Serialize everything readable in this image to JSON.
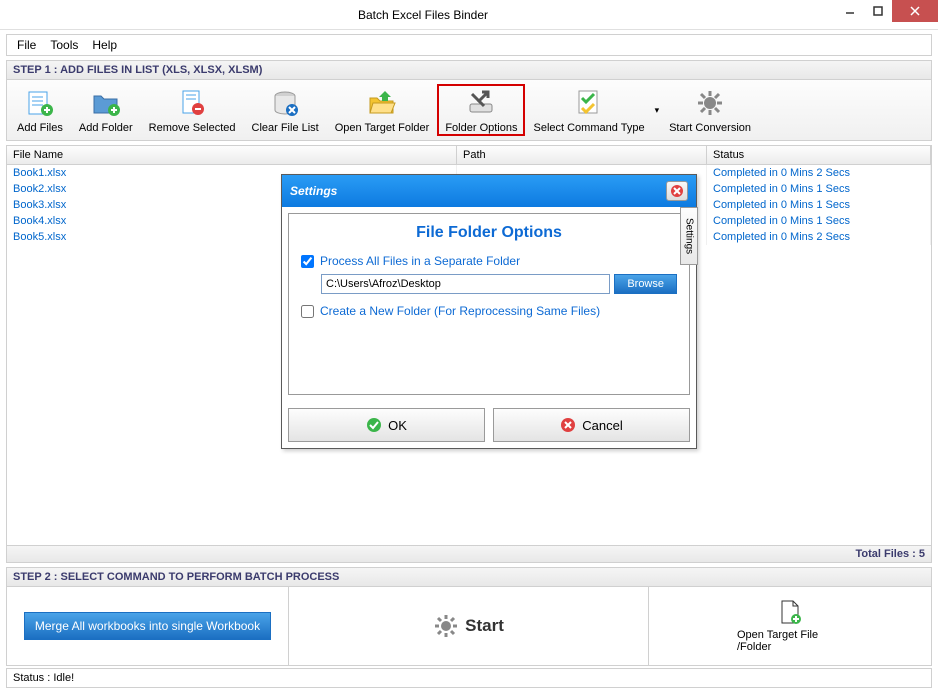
{
  "window": {
    "title": "Batch Excel Files Binder"
  },
  "menu": {
    "file": "File",
    "tools": "Tools",
    "help": "Help"
  },
  "step1": {
    "label": "STEP 1 : ADD FILES IN LIST (XLS, XLSX, XLSM)"
  },
  "toolbar": {
    "add_files": "Add Files",
    "add_folder": "Add Folder",
    "remove_selected": "Remove Selected",
    "clear_list": "Clear File List",
    "open_target": "Open Target Folder",
    "folder_options": "Folder Options",
    "select_command": "Select Command Type",
    "start_conversion": "Start Conversion"
  },
  "grid": {
    "col_filename": "File Name",
    "col_path": "Path",
    "col_status": "Status",
    "rows": [
      {
        "file": "Book1.xlsx",
        "status": "Completed in 0 Mins 2 Secs"
      },
      {
        "file": "Book2.xlsx",
        "status": "Completed in 0 Mins 1 Secs"
      },
      {
        "file": "Book3.xlsx",
        "status": "Completed in 0 Mins 1 Secs"
      },
      {
        "file": "Book4.xlsx",
        "status": "Completed in 0 Mins 1 Secs"
      },
      {
        "file": "Book5.xlsx",
        "status": "Completed in 0 Mins 2 Secs"
      }
    ],
    "total_files": "Total Files : 5"
  },
  "step2": {
    "label": "STEP 2 : SELECT COMMAND TO PERFORM BATCH PROCESS"
  },
  "actions": {
    "merge": "Merge All workbooks into single Workbook",
    "start": "Start",
    "open_target": "Open Target File /Folder"
  },
  "status": {
    "text": "Status  :  Idle!"
  },
  "dialog": {
    "title": "Settings",
    "side_tab": "Settings",
    "heading": "File Folder Options",
    "process_all": "Process All Files in a Separate Folder",
    "path": "C:\\Users\\Afroz\\Desktop",
    "browse": "Browse",
    "create_new": "Create a New Folder (For Reprocessing Same Files)",
    "ok": "OK",
    "cancel": "Cancel"
  }
}
